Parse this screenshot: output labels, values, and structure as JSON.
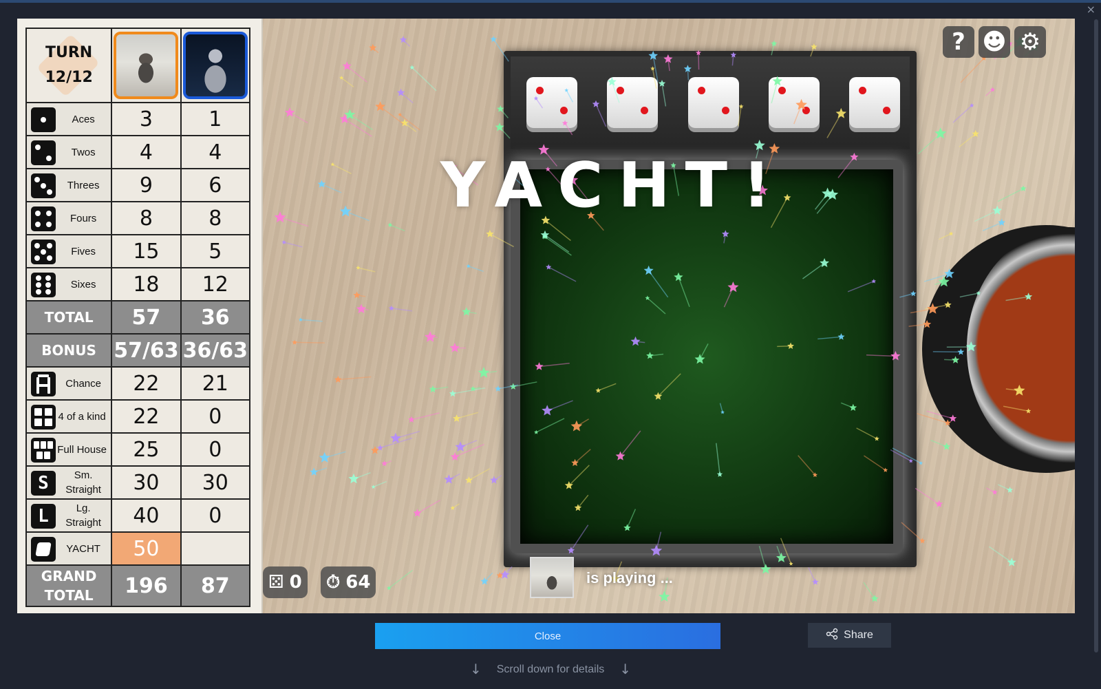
{
  "window": {
    "close_glyph": "×"
  },
  "scorecard": {
    "turn_label": "TURN",
    "turn_value": "12/12",
    "rows": [
      {
        "label": "Aces",
        "icon": "die-one-icon",
        "p1": "3",
        "p2": "1"
      },
      {
        "label": "Twos",
        "icon": "die-two-icon",
        "p1": "4",
        "p2": "4"
      },
      {
        "label": "Threes",
        "icon": "die-three-icon",
        "p1": "9",
        "p2": "6"
      },
      {
        "label": "Fours",
        "icon": "die-four-icon",
        "p1": "8",
        "p2": "8"
      },
      {
        "label": "Fives",
        "icon": "die-five-icon",
        "p1": "15",
        "p2": "5"
      },
      {
        "label": "Sixes",
        "icon": "die-six-icon",
        "p1": "18",
        "p2": "12"
      },
      {
        "label": "TOTAL",
        "p1": "57",
        "p2": "36"
      },
      {
        "label": "BONUS",
        "p1": "57/63",
        "p2": "36/63"
      },
      {
        "label": "Chance",
        "icon": "chance-icon",
        "p1": "22",
        "p2": "21"
      },
      {
        "label": "4 of a kind",
        "icon": "four-of-a-kind-icon",
        "p1": "22",
        "p2": "0"
      },
      {
        "label": "Full House",
        "icon": "full-house-icon",
        "p1": "25",
        "p2": "0"
      },
      {
        "label": "Sm. Straight",
        "icon": "small-straight-icon",
        "p1": "30",
        "p2": "30"
      },
      {
        "label": "Lg. Straight",
        "icon": "large-straight-icon",
        "p1": "40",
        "p2": "0"
      },
      {
        "label": "YACHT",
        "icon": "yacht-icon",
        "p1": "50",
        "p2": ""
      },
      {
        "label_line1": "GRAND",
        "label_line2": "TOTAL",
        "p1": "196",
        "p2": "87"
      }
    ],
    "highlight_color": "#f2a875"
  },
  "board": {
    "banner": "YACHT!",
    "dice_values": [
      2,
      2,
      2,
      2,
      2
    ],
    "rolls_left": "0",
    "timer": "64",
    "status_text": "is playing ..."
  },
  "hud": {
    "help_glyph": "?",
    "emote_glyph": "☻",
    "settings_glyph": "⚙"
  },
  "footer": {
    "close_label": "Close",
    "share_label": "Share",
    "scroll_hint": "Scroll down for details",
    "arrow": "↓"
  }
}
